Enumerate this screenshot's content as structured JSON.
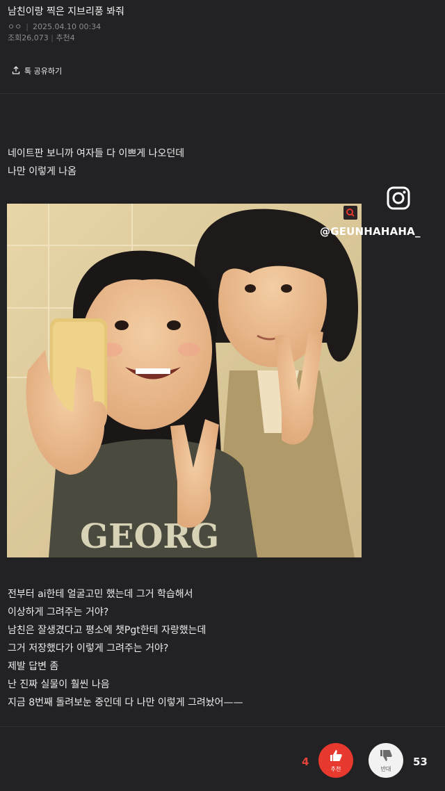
{
  "post": {
    "title": "남친이랑 찍은 지브리풍 봐줘",
    "author": "ㅇㅇ",
    "datetime": "2025.04.10 00:34",
    "views": "조회26,073",
    "recommend": "추천4"
  },
  "share": {
    "label": "톡 공유하기"
  },
  "body": {
    "intro": [
      "네이트판 보니까 여자들 다 이쁘게 나오던데",
      "나만 이렇게 나옴"
    ],
    "paragraphs": [
      "전부터 ai한테 얼굴고민 했는데 그거 학습해서",
      "이상하게 그려주는 거야?",
      "남친은 잘생겼다고 평소에 챗Pgt한테 자랑했는데",
      "그거 저장했다가 이렇게 그려주는 거야?",
      "제발 답변 좀",
      "난 진짜 실물이 훨씬 나음",
      "지금 8번째 돌려보눈 중인데 다 나만 이렇게 그려놨어——"
    ]
  },
  "overlay": {
    "instagram_handle": "@GEUNHAHAHA_"
  },
  "image": {
    "shirt_text": "GEORG"
  },
  "votes": {
    "up_count": "4",
    "up_label": "추천",
    "down_count": "53",
    "down_label": "반대"
  },
  "colors": {
    "accent": "#e8392e",
    "background": "#222124",
    "text_muted": "#8c8c90"
  }
}
